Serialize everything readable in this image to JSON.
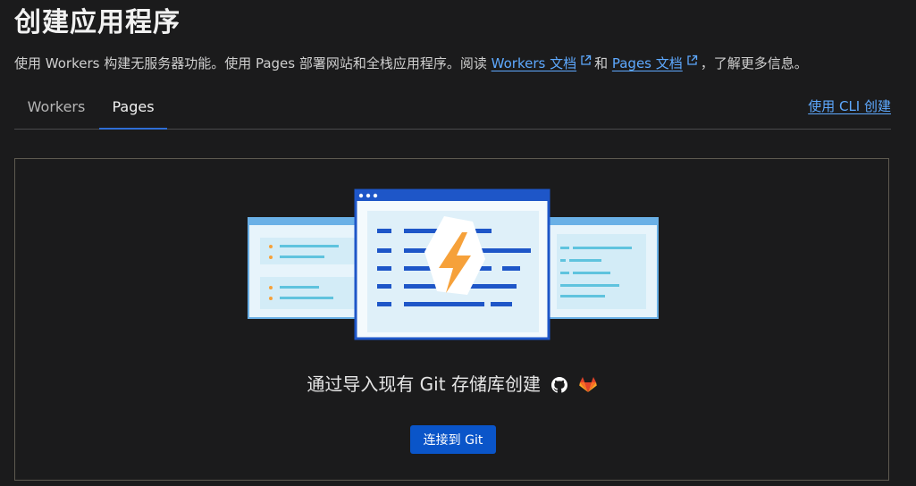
{
  "header": {
    "title": "创建应用程序",
    "desc_part1": "使用 Workers 构建无服务器功能。使用 Pages 部署网站和全栈应用程序。阅读 ",
    "workers_docs_link": "Workers 文档",
    "desc_and": "和 ",
    "pages_docs_link": "Pages 文档",
    "desc_part2": "，了解更多信息。"
  },
  "tabs": [
    {
      "label": "Workers",
      "active": false
    },
    {
      "label": "Pages",
      "active": true
    }
  ],
  "cli_link": "使用 CLI 创建",
  "main": {
    "cta_text": "通过导入现有 Git 存储库创建",
    "connect_button": "连接到 Git",
    "icons": [
      "external-link-icon",
      "github-icon",
      "gitlab-icon",
      "lightning-icon"
    ]
  },
  "colors": {
    "accent": "#0a55c9",
    "link": "#5ea9ff",
    "illustration_blue": "#1e56c8",
    "illustration_orange": "#f6a13a"
  }
}
